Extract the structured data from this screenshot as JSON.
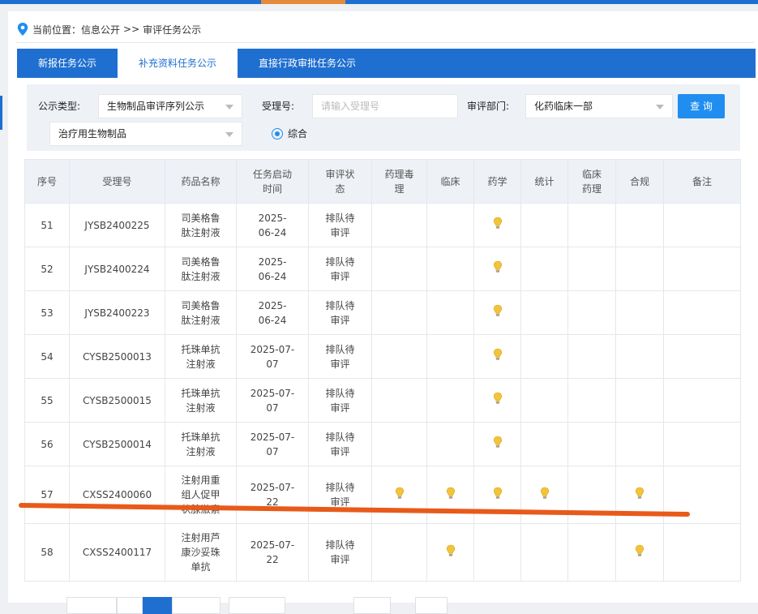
{
  "breadcrumb": {
    "label": "当前位置：",
    "section": "信息公开",
    "separator": ">>",
    "current": "审评任务公示"
  },
  "tabs": [
    {
      "label": "新报任务公示",
      "active": false
    },
    {
      "label": "补充资料任务公示",
      "active": true
    },
    {
      "label": "直接行政审批任务公示",
      "active": false
    }
  ],
  "filters": {
    "type_label": "公示类型:",
    "type_value": "生物制品审评序列公示",
    "subtype_value": "治疗用生物制品",
    "accept_label": "受理号:",
    "accept_placeholder": "请输入受理号",
    "dept_label": "审评部门:",
    "dept_value": "化药临床一部",
    "query_label": "查 询",
    "radio_label": "综合"
  },
  "table": {
    "headers": [
      "序号",
      "受理号",
      "药品名称",
      "任务启动时间",
      "审评状态",
      "药理毒理",
      "临床",
      "药学",
      "统计",
      "临床药理",
      "合规",
      "备注"
    ],
    "header_lines": [
      [
        "序号"
      ],
      [
        "受理号"
      ],
      [
        "药品名称"
      ],
      [
        "任务启动",
        "时间"
      ],
      [
        "审评状",
        "态"
      ],
      [
        "药理毒",
        "理"
      ],
      [
        "临床"
      ],
      [
        "药学"
      ],
      [
        "统计"
      ],
      [
        "临床",
        "药理"
      ],
      [
        "合规"
      ],
      [
        "备注"
      ]
    ],
    "rows": [
      {
        "seq": "51",
        "no": "JYSB2400225",
        "name": [
          "司美格鲁",
          "肽注射液"
        ],
        "date": [
          "2025-",
          "06-24"
        ],
        "status": [
          "排队待",
          "审评"
        ],
        "marks": [
          false,
          false,
          true,
          false,
          false,
          false
        ]
      },
      {
        "seq": "52",
        "no": "JYSB2400224",
        "name": [
          "司美格鲁",
          "肽注射液"
        ],
        "date": [
          "2025-",
          "06-24"
        ],
        "status": [
          "排队待",
          "审评"
        ],
        "marks": [
          false,
          false,
          true,
          false,
          false,
          false
        ]
      },
      {
        "seq": "53",
        "no": "JYSB2400223",
        "name": [
          "司美格鲁",
          "肽注射液"
        ],
        "date": [
          "2025-",
          "06-24"
        ],
        "status": [
          "排队待",
          "审评"
        ],
        "marks": [
          false,
          false,
          true,
          false,
          false,
          false
        ]
      },
      {
        "seq": "54",
        "no": "CYSB2500013",
        "name": [
          "托珠单抗",
          "注射液"
        ],
        "date": [
          "2025-07-",
          "07"
        ],
        "status": [
          "排队待",
          "审评"
        ],
        "marks": [
          false,
          false,
          true,
          false,
          false,
          false
        ]
      },
      {
        "seq": "55",
        "no": "CYSB2500015",
        "name": [
          "托珠单抗",
          "注射液"
        ],
        "date": [
          "2025-07-",
          "07"
        ],
        "status": [
          "排队待",
          "审评"
        ],
        "marks": [
          false,
          false,
          true,
          false,
          false,
          false
        ]
      },
      {
        "seq": "56",
        "no": "CYSB2500014",
        "name": [
          "托珠单抗",
          "注射液"
        ],
        "date": [
          "2025-07-",
          "07"
        ],
        "status": [
          "排队待",
          "审评"
        ],
        "marks": [
          false,
          false,
          true,
          false,
          false,
          false
        ]
      },
      {
        "seq": "57",
        "no": "CXSS2400060",
        "name": [
          "注射用重",
          "组人促甲",
          "状腺激素"
        ],
        "date": [
          "2025-07-",
          "22"
        ],
        "status": [
          "排队待",
          "审评"
        ],
        "marks": [
          true,
          true,
          true,
          true,
          false,
          true
        ]
      },
      {
        "seq": "58",
        "no": "CXSS2400117",
        "name": [
          "注射用芦",
          "康沙妥珠",
          "单抗"
        ],
        "date": [
          "2025-07-",
          "22"
        ],
        "status": [
          "排队待",
          "审评"
        ],
        "marks": [
          false,
          true,
          false,
          false,
          false,
          true
        ]
      }
    ]
  },
  "colors": {
    "brand_blue": "#1f6fd0",
    "query_blue": "#1f8ef0",
    "bulb_yellow": "#f2c43a",
    "annotation_red": "#e85a1a"
  },
  "icons": {
    "location": "location-pin-icon",
    "review_mark": "lightbulb-icon"
  }
}
